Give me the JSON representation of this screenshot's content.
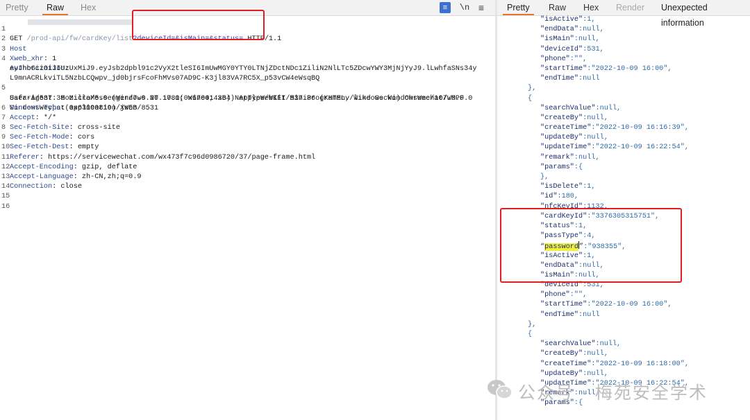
{
  "left_tabs": {
    "pretty": "Pretty",
    "raw": "Raw",
    "hex": "Hex"
  },
  "left_icons": {
    "wrap": "list-icon",
    "newline_label": "\\n",
    "menu": "menu-icon"
  },
  "request": {
    "line1": {
      "num": "1",
      "method": "GET",
      "path_obscured": " /prod-api/fw/cardKey/list",
      "query": "?deviceId=&isMain=&status=",
      "protocol": " HTTP/1.1"
    },
    "lines": [
      {
        "num": "2",
        "key": "Host",
        "value": ""
      },
      {
        "num": "3",
        "key": "Xweb_xhr",
        "value": ": 1"
      },
      {
        "num": "4",
        "key": "Authorization",
        "value": ":"
      }
    ],
    "auth_cont": [
      "eyJhbGciOiJIUzUxMiJ9.eyJsb2dpbl91c2VyX2tleSI6ImUwMGY0YTY0LTNjZDctNDc1ZiliN2NlLTc5ZDcwYWY3MjNjYyJ9.lLwhfaSNs34y",
      "L9mnACRLkviTL5NzbLCQwpv_jd0bjrsFcoFhMVs07AD9C-K3jl83VA7RC5X_p53vCW4eWsqBQ"
    ],
    "ua": {
      "num": "5",
      "line1": "User-Agent: Mozilla/5.0 (Windows NT 10.0; Win64; x64) AppleWebKit/537.36 (KHTML, like Gecko) Chrome/107.0.0.0",
      "line2": "Safari/537.36 MicroMessenger/7.0.20.1781(0x6700143B) NetType/WIFI MiniProgramEnv/Windows WindowsWechat/WMPF",
      "line3": "WindowsWechat(0x63090819) XWEB/8531"
    },
    "rest": [
      {
        "num": "6",
        "key": "Content-Type",
        "value": ": application/json"
      },
      {
        "num": "7",
        "key": "Accept",
        "value": ": */*"
      },
      {
        "num": "8",
        "key": "Sec-Fetch-Site",
        "value": ": cross-site"
      },
      {
        "num": "9",
        "key": "Sec-Fetch-Mode",
        "value": ": cors"
      },
      {
        "num": "10",
        "key": "Sec-Fetch-Dest",
        "value": ": empty"
      },
      {
        "num": "11",
        "key": "Referer",
        "value": ": https://servicewechat.com/wx473f7c96d0986720/37/page-frame.html"
      },
      {
        "num": "12",
        "key": "Accept-Encoding",
        "value": ": gzip, deflate"
      },
      {
        "num": "13",
        "key": "Accept-Language",
        "value": ": zh-CN,zh;q=0.9"
      },
      {
        "num": "14",
        "key": "Connection",
        "value": ": close"
      },
      {
        "num": "15",
        "key": "",
        "value": ""
      },
      {
        "num": "16",
        "key": "",
        "value": ""
      }
    ]
  },
  "right_tabs": {
    "pretty": "Pretty",
    "raw": "Raw",
    "hex": "Hex",
    "render": "Render",
    "unexpected": "Unexpected information"
  },
  "response": {
    "lines": [
      {
        "i": 9,
        "k": "\"isActive\"",
        "v": ":1,"
      },
      {
        "i": 9,
        "k": "\"endData\"",
        "v": ":null,"
      },
      {
        "i": 9,
        "k": "\"isMain\"",
        "v": ":null,"
      },
      {
        "i": 9,
        "k": "\"deviceId\"",
        "v": ":531,"
      },
      {
        "i": 9,
        "k": "\"phone\"",
        "v": ":\"\","
      },
      {
        "i": 9,
        "k": "\"startTime\"",
        "v": ":\"2022-10-09 16:00\","
      },
      {
        "i": 9,
        "k": "\"endTime\"",
        "v": ":null"
      },
      {
        "i": 6,
        "k": "",
        "v": "},"
      },
      {
        "i": 6,
        "k": "",
        "v": "{"
      },
      {
        "i": 9,
        "k": "\"searchValue\"",
        "v": ":null,"
      },
      {
        "i": 9,
        "k": "\"createBy\"",
        "v": ":null,"
      },
      {
        "i": 9,
        "k": "\"createTime\"",
        "v": ":\"2022-10-09 16:16:39\","
      },
      {
        "i": 9,
        "k": "\"updateBy\"",
        "v": ":null,"
      },
      {
        "i": 9,
        "k": "\"updateTime\"",
        "v": ":\"2022-10-09 16:22:54\","
      },
      {
        "i": 9,
        "k": "\"remark\"",
        "v": ":null,"
      },
      {
        "i": 9,
        "k": "\"params\"",
        "v": ":{"
      },
      {
        "i": 9,
        "k": "",
        "v": "},"
      },
      {
        "i": 9,
        "k": "\"isDelete\"",
        "v": ":1,"
      },
      {
        "i": 9,
        "k": "\"id\"",
        "v": ":180,"
      },
      {
        "i": 9,
        "k": "\"nfcKeyId\"",
        "v": ":1132,"
      },
      {
        "i": 9,
        "k": "\"cardKeyId\"",
        "v": ":\"3376305315751\","
      },
      {
        "i": 9,
        "k": "\"status\"",
        "v": ":1,"
      },
      {
        "i": 9,
        "k": "\"passType\"",
        "v": ":4,"
      },
      {
        "i": 9,
        "k": "\"password\"",
        "v": ":\"938355\",",
        "highlight": true
      },
      {
        "i": 9,
        "k": "\"isActive\"",
        "v": ":1,"
      },
      {
        "i": 9,
        "k": "\"endData\"",
        "v": ":null,"
      },
      {
        "i": 9,
        "k": "\"isMain\"",
        "v": ":null,"
      },
      {
        "i": 9,
        "k": "\"deviceId\"",
        "v": ":531,"
      },
      {
        "i": 9,
        "k": "\"phone\"",
        "v": ":\"\","
      },
      {
        "i": 9,
        "k": "\"startTime\"",
        "v": ":\"2022-10-09 16:00\","
      },
      {
        "i": 9,
        "k": "\"endTime\"",
        "v": ":null"
      },
      {
        "i": 6,
        "k": "",
        "v": "},"
      },
      {
        "i": 6,
        "k": "",
        "v": "{"
      },
      {
        "i": 9,
        "k": "\"searchValue\"",
        "v": ":null,"
      },
      {
        "i": 9,
        "k": "\"createBy\"",
        "v": ":null,"
      },
      {
        "i": 9,
        "k": "\"createTime\"",
        "v": ":\"2022-10-09 16:18:00\","
      },
      {
        "i": 9,
        "k": "\"updateBy\"",
        "v": ":null,"
      },
      {
        "i": 9,
        "k": "\"updateTime\"",
        "v": ":\"2022-10-09 16:22:54\","
      },
      {
        "i": 9,
        "k": "\"remark\"",
        "v": ":null,"
      },
      {
        "i": 9,
        "k": "\"params\"",
        "v": ":{"
      },
      {
        "i": 9,
        "k": "",
        "v": ""
      }
    ]
  },
  "watermark": {
    "text": "公众号 · 梅苑安全学术",
    "icon": "wechat-icon"
  },
  "colors": {
    "accent": "#e8732a",
    "highlight_box": "#e02020",
    "password_highlight": "#f0f040"
  }
}
